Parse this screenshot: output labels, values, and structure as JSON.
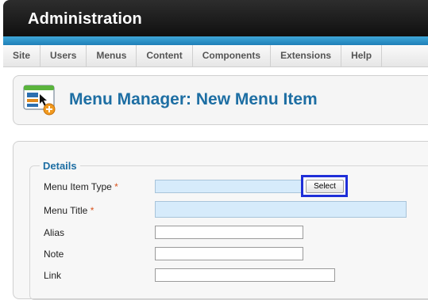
{
  "header": {
    "title": "Administration"
  },
  "menubar": {
    "items": [
      "Site",
      "Users",
      "Menus",
      "Content",
      "Components",
      "Extensions",
      "Help"
    ]
  },
  "toolbar": {
    "title": "Menu Manager: New Menu Item",
    "icon": "menu-manager-icon"
  },
  "form": {
    "legend": "Details",
    "required_marker": "*",
    "fields": [
      {
        "label": "Menu Item Type",
        "required": true,
        "value": "",
        "button": "Select"
      },
      {
        "label": "Menu Title",
        "required": true,
        "value": ""
      },
      {
        "label": "Alias",
        "required": false,
        "value": ""
      },
      {
        "label": "Note",
        "required": false,
        "value": ""
      },
      {
        "label": "Link",
        "required": false,
        "value": ""
      }
    ]
  },
  "colors": {
    "accent_blue": "#1d6ea3",
    "required_field_bg": "#d6ebfb",
    "highlight_border": "#1f2fd8",
    "required_star": "#d9531e"
  }
}
